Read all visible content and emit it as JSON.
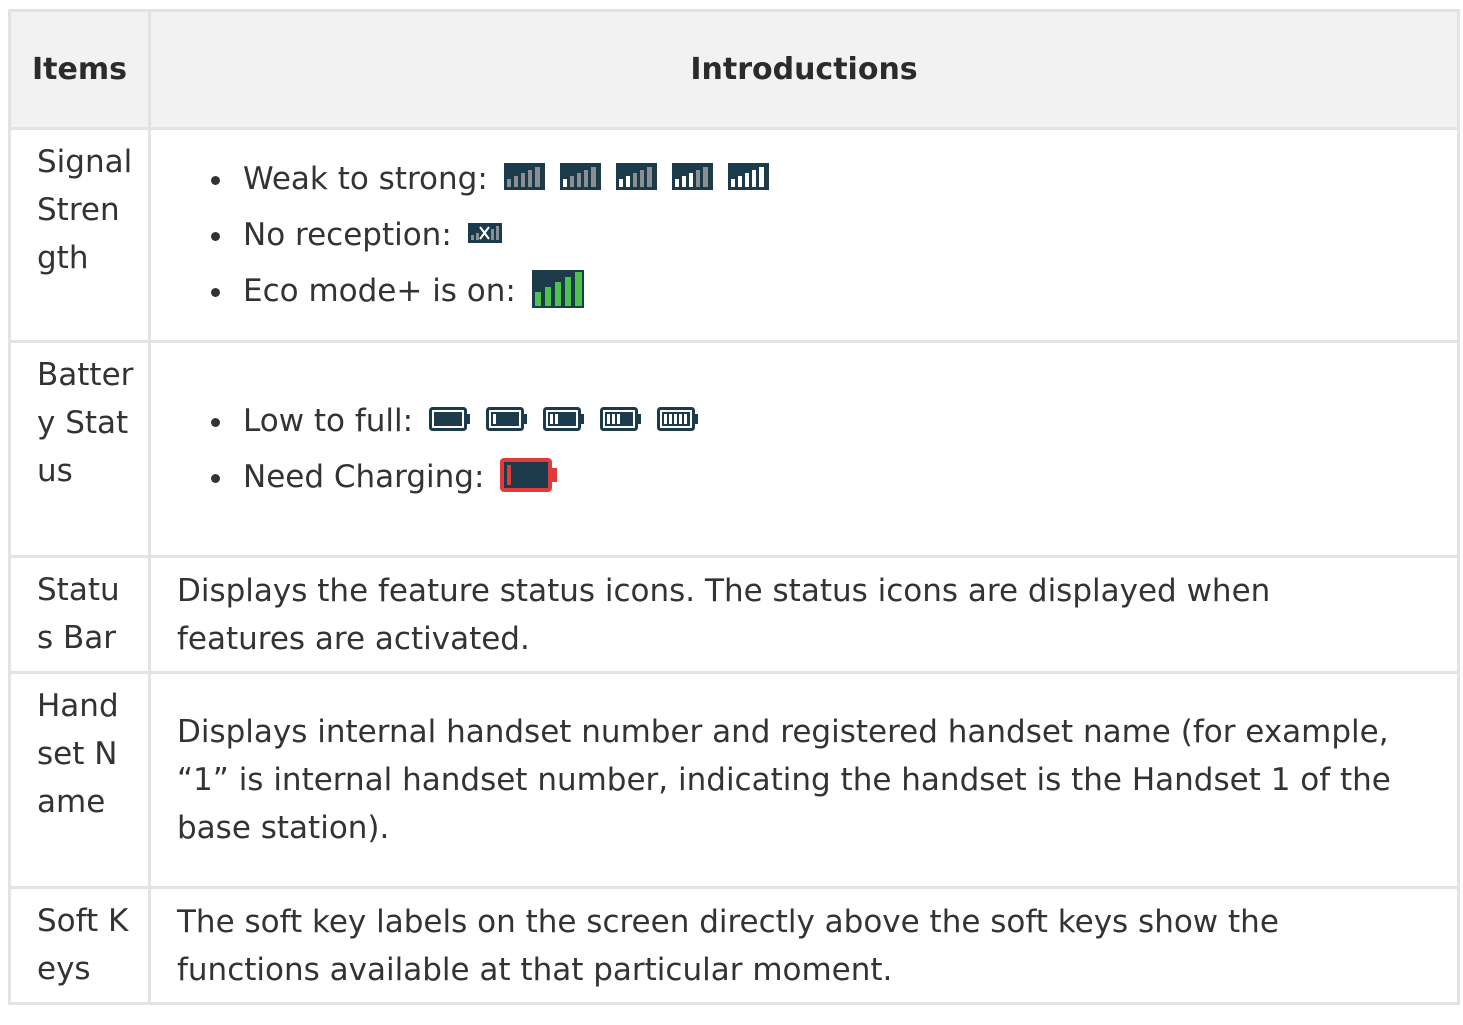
{
  "table": {
    "headers": {
      "item": "Items",
      "intro": "Introductions"
    },
    "signal": {
      "item": "Signal Strength",
      "weak_to_strong": "Weak to strong:",
      "no_reception": "No reception:",
      "eco_mode": "Eco mode+ is on:"
    },
    "battery": {
      "item": "Battery Status",
      "low_to_full": "Low to full:",
      "need_charging": "Need Charging:"
    },
    "status_bar": {
      "item": "Status Bar",
      "description": "Displays the feature status icons. The status icons are displayed when features are activated."
    },
    "handset_name": {
      "item": "Handset Name",
      "description": "Displays internal handset number and registered handset name (for example, “1” is internal handset number, indicating the handset is the Handset 1 of the base station)."
    },
    "soft_keys": {
      "item": "Soft Keys",
      "description": "The soft key labels on the screen directly above the soft keys show the functions available at that particular moment."
    }
  },
  "icons": {
    "signal": [
      "signal-0-icon",
      "signal-1-icon",
      "signal-2-icon",
      "signal-3-icon",
      "signal-4-icon"
    ],
    "no_reception": "no-reception-icon",
    "eco_mode": "eco-signal-icon",
    "battery": [
      "battery-0-icon",
      "battery-1-icon",
      "battery-2-icon",
      "battery-3-icon",
      "battery-4-icon"
    ],
    "need_charging": "battery-empty-icon"
  },
  "colors": {
    "icon_dark": "#1c3b4a",
    "icon_muted": "#8a8f93",
    "eco_green": "#4ec24e",
    "alert_red": "#e03a3a",
    "header_bg": "#f2f2f2",
    "border": "#e3e3e3"
  }
}
